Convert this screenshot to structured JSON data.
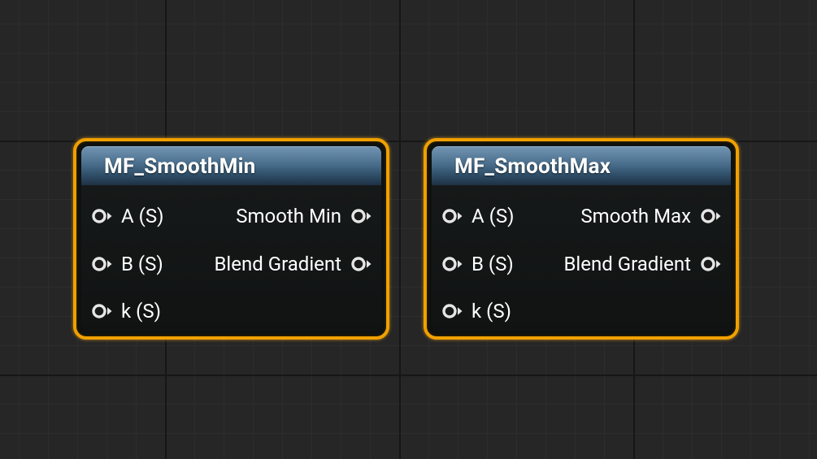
{
  "nodes": [
    {
      "title": "MF_SmoothMin",
      "inputs": [
        {
          "label": "A (S)"
        },
        {
          "label": "B (S)"
        },
        {
          "label": "k (S)"
        }
      ],
      "outputs": [
        {
          "label": "Smooth Min"
        },
        {
          "label": "Blend Gradient"
        }
      ]
    },
    {
      "title": "MF_SmoothMax",
      "inputs": [
        {
          "label": "A (S)"
        },
        {
          "label": "B (S)"
        },
        {
          "label": "k (S)"
        }
      ],
      "outputs": [
        {
          "label": "Smooth Max"
        },
        {
          "label": "Blend Gradient"
        }
      ]
    }
  ],
  "colors": {
    "selection_outline": "#f0a000",
    "header": "#4a6f8d",
    "node_body": "#111313",
    "pin": "#e8e8e8",
    "canvas_background": "#262626"
  },
  "icons": {
    "pin": "scalar-pin-icon"
  }
}
